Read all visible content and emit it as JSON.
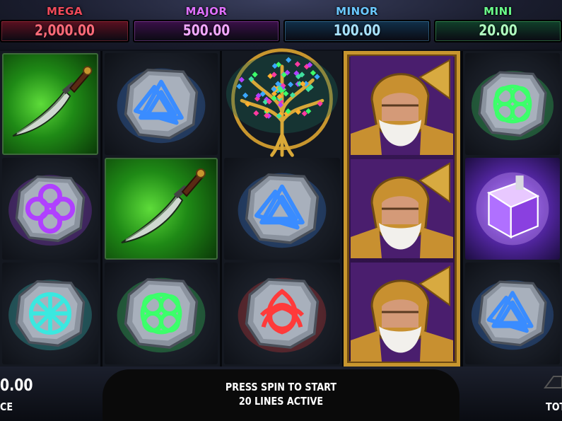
{
  "jackpots": [
    {
      "label": "MEGA",
      "value": "2,000.00",
      "label_color": "#f04a5a",
      "bar_color": "#5a1020",
      "value_color": "#ff6a78"
    },
    {
      "label": "MAJOR",
      "value": "500.00",
      "label_color": "#e070ff",
      "bar_color": "#3a1048",
      "value_color": "#f2a8ff"
    },
    {
      "label": "MINOR",
      "value": "100.00",
      "label_color": "#6ac8ff",
      "bar_color": "#10304a",
      "value_color": "#a8e2ff"
    },
    {
      "label": "MINI",
      "value": "20.00",
      "label_color": "#6aff8a",
      "bar_color": "#10402a",
      "value_color": "#b0ffc0"
    }
  ],
  "reels": [
    [
      "dagger-green",
      "rune-purple-knot",
      "rune-teal-star"
    ],
    [
      "rune-blue-valknut",
      "dagger-green",
      "rune-green-knot"
    ],
    [
      "tree-of-life",
      "rune-blue-valknut",
      "rune-red-triquetra"
    ],
    [
      "odin-tall",
      "odin-tall",
      "odin-tall"
    ],
    [
      "rune-green-knot",
      "mystery-cube-purple",
      "rune-blue-valknut"
    ]
  ],
  "status": {
    "line1": "PRESS SPIN TO START",
    "line2": "20 LINES ACTIVE"
  },
  "balance": {
    "value_partial": "0.00",
    "label_partial": "CE"
  },
  "total_bet": {
    "label_partial": "TOT"
  },
  "colors": {
    "gold": "#c8962e",
    "rune_blue": "#3a8cff",
    "rune_green": "#3cff6a",
    "rune_red": "#ff3a3a",
    "rune_purple": "#b040ff",
    "rune_teal": "#3ae8e0"
  }
}
